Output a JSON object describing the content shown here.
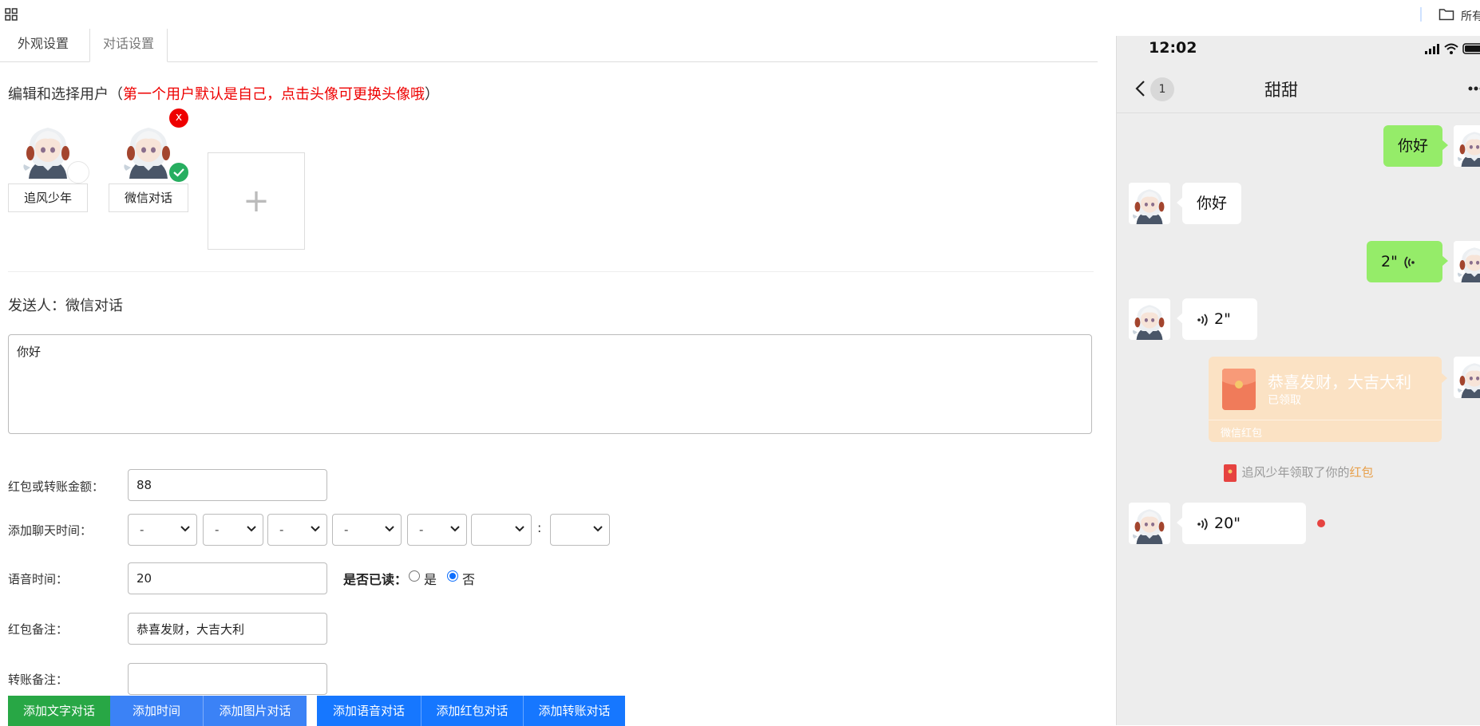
{
  "topbar": {
    "folder_label": "所有"
  },
  "tabs": [
    {
      "label": "外观设置"
    },
    {
      "label": "对话设置"
    }
  ],
  "users_section": {
    "title_prefix": "编辑和选择用户（",
    "title_note": "第一个用户默认是自己，点击头像可更换头像哦",
    "title_suffix": "）",
    "users": [
      {
        "name": "追风少年"
      },
      {
        "name": "微信对话"
      }
    ],
    "delete_badge": "x",
    "add_symbol": "+"
  },
  "sender": {
    "label": "发送人：",
    "name": "微信对话"
  },
  "message": {
    "value": "你好"
  },
  "form": {
    "amount_label": "红包或转账金额：",
    "amount_value": "88",
    "time_label": "添加聊天时间：",
    "time_selects": [
      "-",
      "-",
      "-",
      "-",
      "-",
      "",
      ""
    ],
    "time_colon": ":",
    "voice_label": "语音时间：",
    "voice_value": "20",
    "read_label": "是否已读：",
    "read_yes": "是",
    "read_no": "否",
    "read_selected": "否",
    "redpacket_note_label": "红包备注：",
    "redpacket_note_value": "恭喜发财，大吉大利",
    "transfer_note_label": "转账备注：",
    "transfer_note_value": ""
  },
  "buttons": {
    "add_text": "添加文字对话",
    "add_time": "添加时间",
    "add_image": "添加图片对话",
    "add_voice": "添加语音对话",
    "add_redpacket": "添加红包对话",
    "add_transfer": "添加转账对话"
  },
  "phone": {
    "time": "12:02",
    "unread_count": "1",
    "chat_title": "甜甜",
    "messages": {
      "m1": "你好",
      "m2": "你好",
      "m3": "2\"",
      "m4": "2\"",
      "m6": "20\""
    },
    "redpacket": {
      "title": "恭喜发财，大吉大利",
      "status": "已领取",
      "brand": "微信红包"
    },
    "system": {
      "text": "追风少年领取了你的",
      "highlight": "红包"
    }
  },
  "colors": {
    "green_bubble": "#95ec69",
    "primary_blue": "#1677ff",
    "success_green": "#28a745",
    "danger_red": "#ee0000"
  }
}
